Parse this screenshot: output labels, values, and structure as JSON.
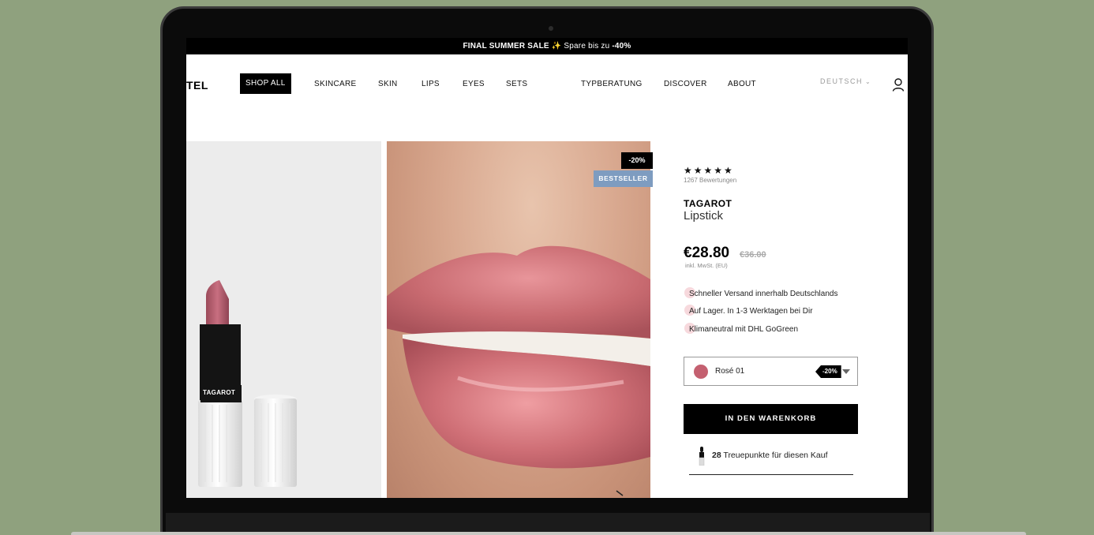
{
  "promo": {
    "bold": "FINAL SUMMER SALE",
    "sparkle": "✨",
    "text": " Spare bis zu ",
    "discount": "-40%"
  },
  "header": {
    "logo": "TEL",
    "nav": [
      "SHOP ALL",
      "SKINCARE",
      "SKIN",
      "LIPS",
      "EYES",
      "SETS",
      "TYPBERATUNG",
      "DISCOVER",
      "ABOUT"
    ],
    "language": "DEUTSCH"
  },
  "gallery": {
    "product_label": "TAGAROT",
    "badge_discount": "-20%",
    "badge_tag": "BESTSELLER"
  },
  "product": {
    "stars": "★★★★★",
    "reviews": "1267 Bewertungen",
    "brand": "TAGAROT",
    "name": "Lipstick",
    "price": "€28.80",
    "price_old": "€36.00",
    "vat": "inkl. MwSt. (EU)",
    "features": [
      "Schneller Versand innerhalb Deutschlands",
      "Auf Lager. In 1-3 Werktagen bei Dir",
      "Klimaneutral mit DHL GoGreen"
    ],
    "variant": {
      "name": "Rosé 01",
      "discount": "-20%",
      "swatch_color": "#c46070"
    },
    "cart_button": "IN DEN WARENKORB",
    "points_value": "28",
    "points_text": " Treuepunkte für diesen Kauf"
  },
  "colors": {
    "background": "#8fa17e",
    "bestseller": "#7e9cc0",
    "feature_dot": "#f7d9dd"
  }
}
